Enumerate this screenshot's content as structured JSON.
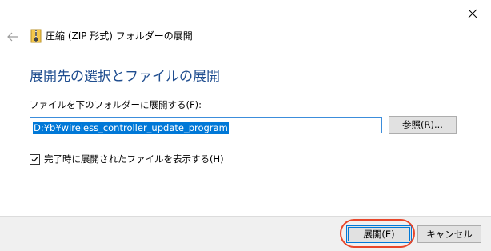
{
  "window": {
    "title": "圧縮 (ZIP 形式) フォルダーの展開"
  },
  "icons": {
    "close": "close-icon",
    "back": "back-arrow-icon",
    "app": "zip-folder-icon",
    "check": "checkmark-icon"
  },
  "main": {
    "heading": "展開先の選択とファイルの展開",
    "dest_label": "ファイルを下のフォルダーに展開する(F):",
    "path_value": "D:¥b¥wireless_controller_update_program",
    "browse_label": "参照(R)...",
    "checkbox_label": "完了時に展開されたファイルを表示する(H)",
    "checkbox_checked": true
  },
  "footer": {
    "extract_label": "展開(E)",
    "cancel_label": "キャンセル"
  },
  "colors": {
    "heading": "#1f4d8f",
    "selection": "#0078d7",
    "highlight_ring": "#e8462a",
    "footer_bg": "#f0f0f0"
  }
}
